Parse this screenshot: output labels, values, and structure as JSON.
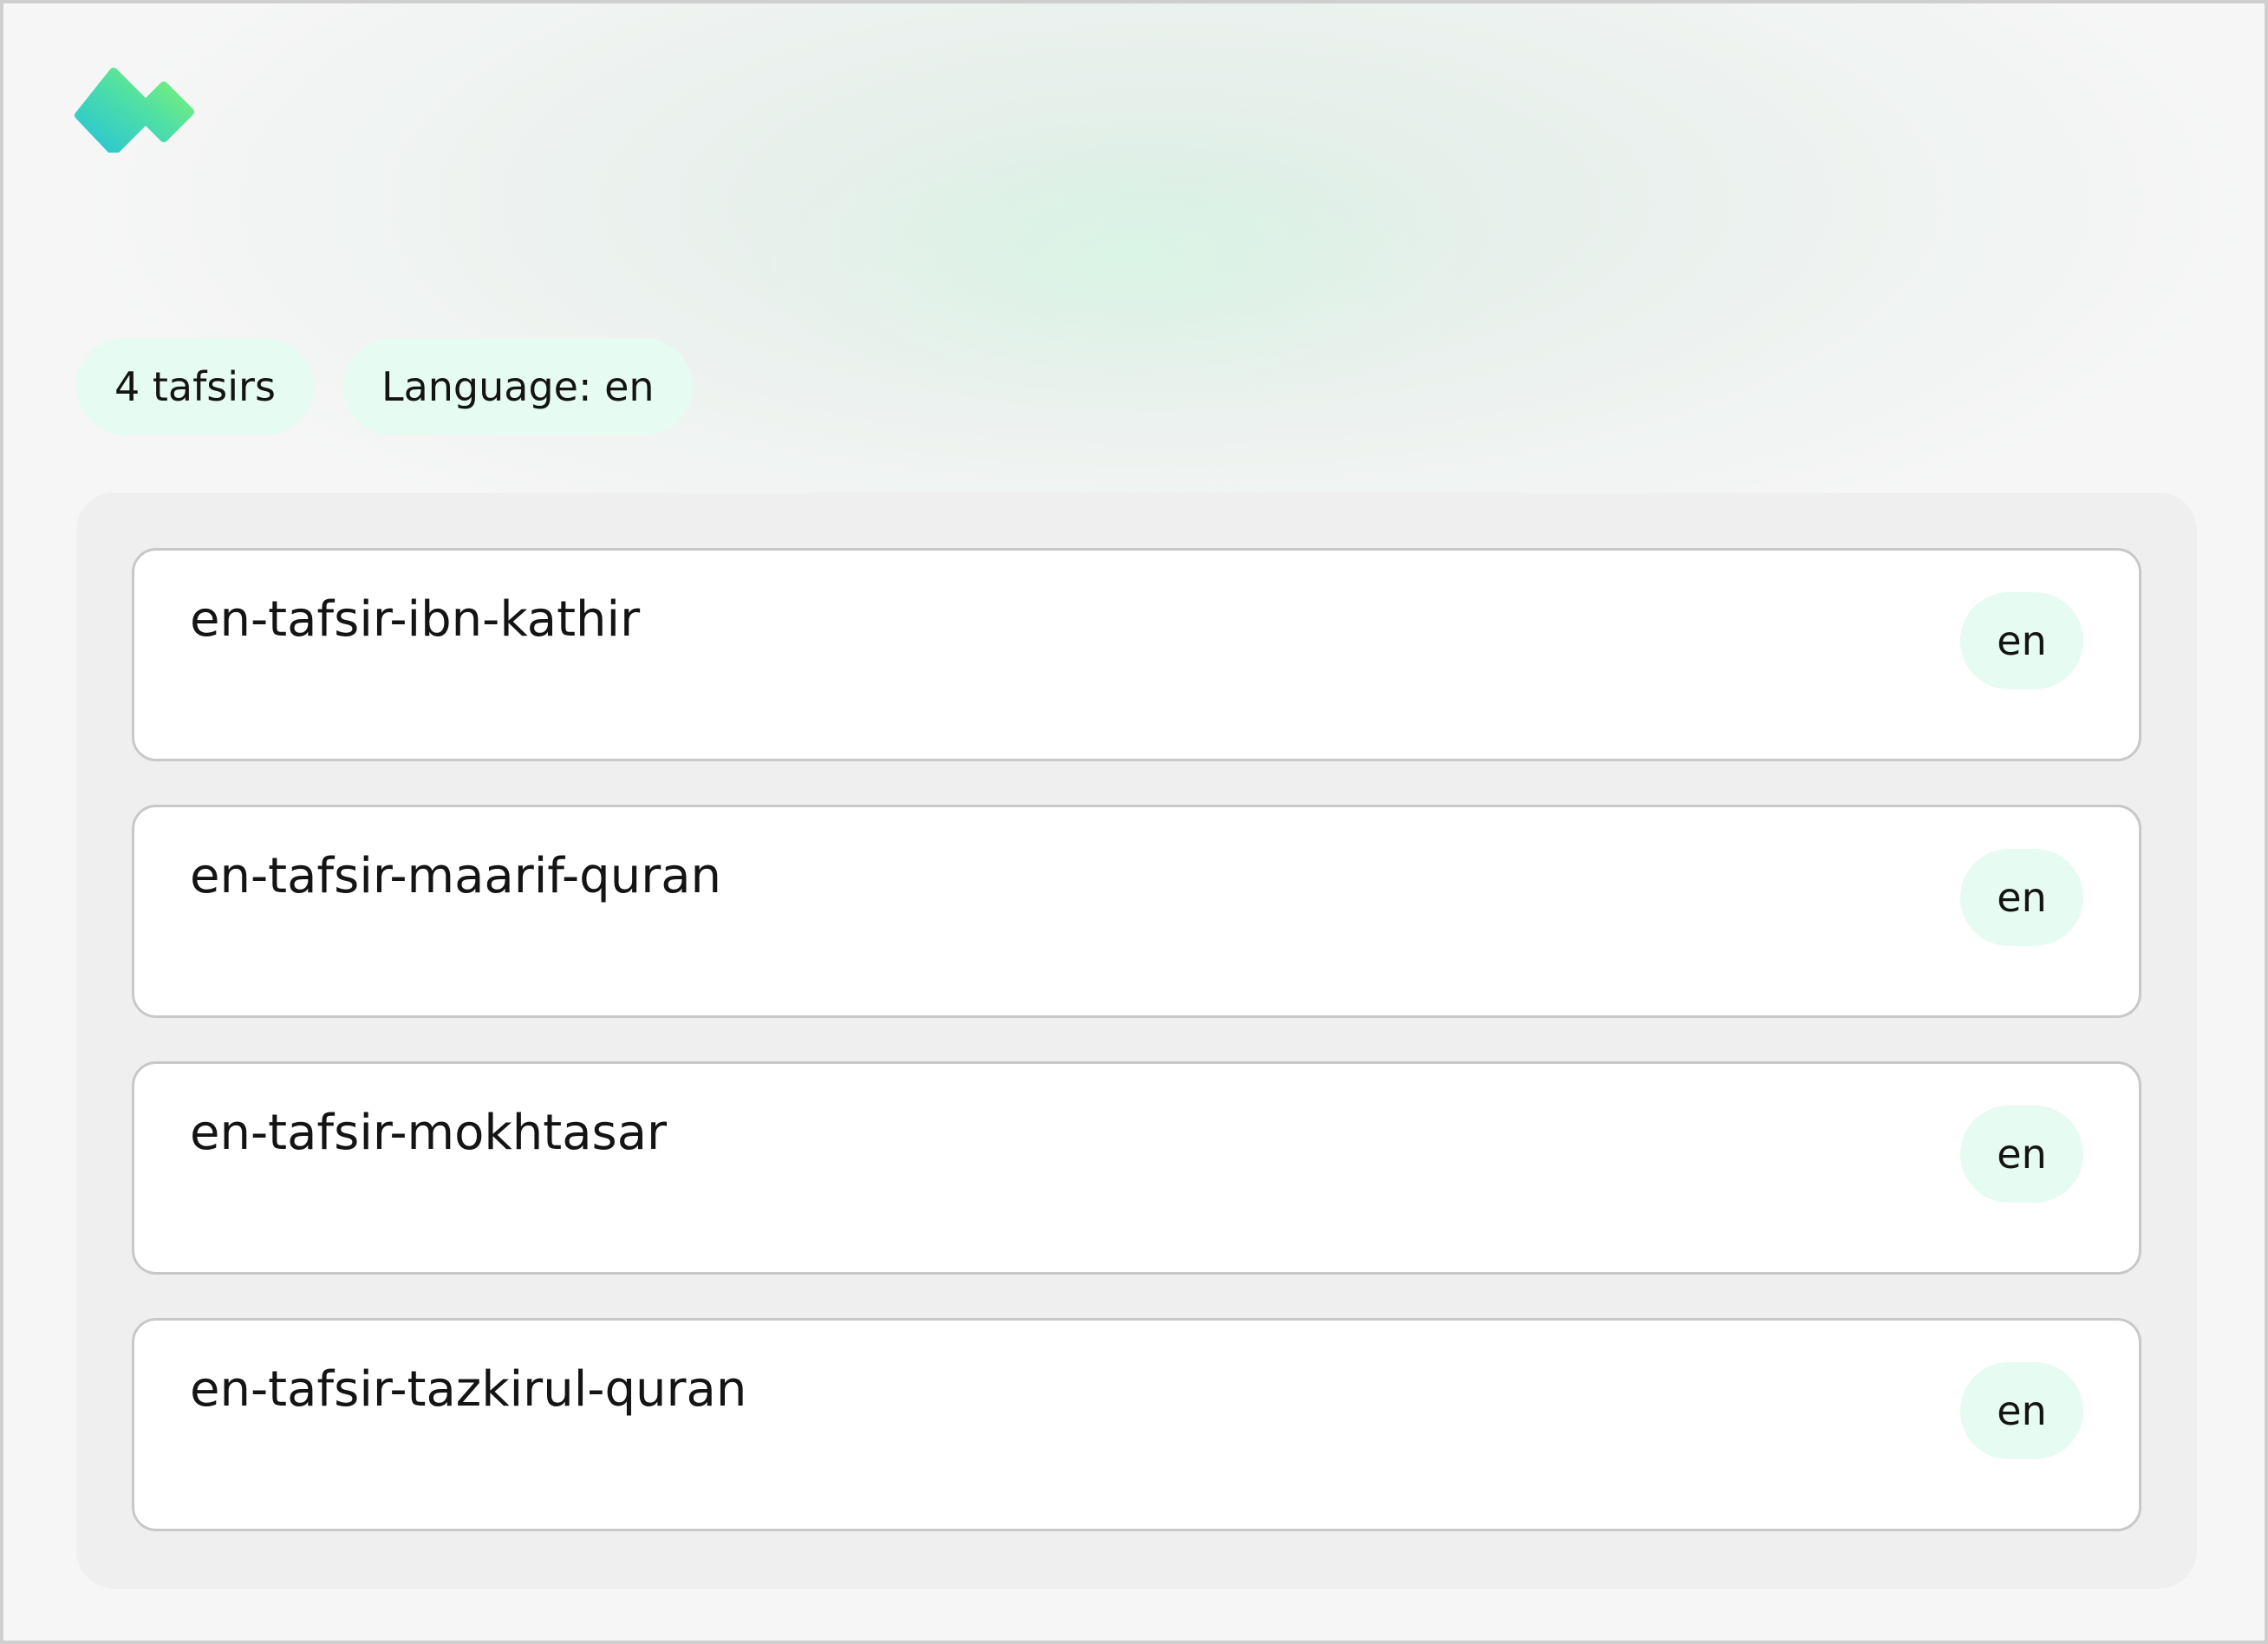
{
  "logo": {
    "icon": "diamond-logo-icon",
    "gradient": [
      "#2cc6d9",
      "#74f27a"
    ]
  },
  "summary": {
    "count_label": "4 tafsirs",
    "language_label": "Language: en"
  },
  "tafsirs": [
    {
      "slug": "en-tafsir-ibn-kathir",
      "lang": "en"
    },
    {
      "slug": "en-tafsir-maarif-quran",
      "lang": "en"
    },
    {
      "slug": "en-tafsir-mokhtasar",
      "lang": "en"
    },
    {
      "slug": "en-tafsir-tazkirul-quran",
      "lang": "en"
    }
  ],
  "colors": {
    "badge_bg": "#e6fbf1",
    "panel_bg": "#efefef",
    "card_border": "#c8c8c8"
  }
}
